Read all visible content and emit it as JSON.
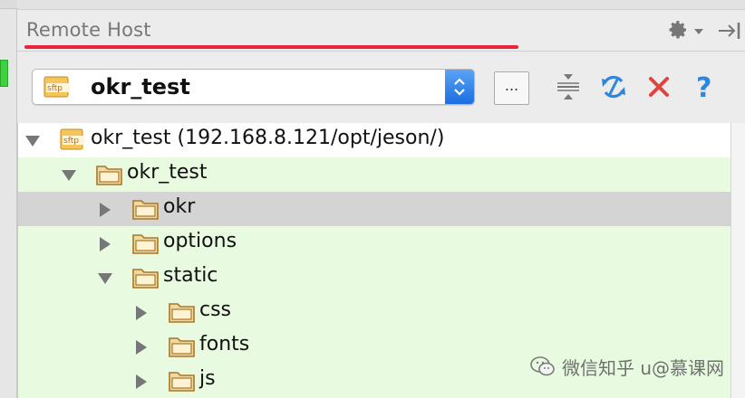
{
  "panel": {
    "title": "Remote Host",
    "accent_underline_color": "#e8253c"
  },
  "header_icons": {
    "settings": "gear-icon",
    "settings_menu": "chevron-down-icon",
    "hide": "hide-panel-icon"
  },
  "toolbar": {
    "host_select": {
      "value": "okr_test",
      "icon": "sftp-icon",
      "icon_text": "sftp"
    },
    "browse_label": "...",
    "actions": [
      {
        "name": "collapse-all-icon"
      },
      {
        "name": "sync-icon",
        "color": "#2e86de"
      },
      {
        "name": "close-icon",
        "color": "#e0443e"
      },
      {
        "name": "help-icon",
        "color": "#2e86de"
      }
    ]
  },
  "tree": {
    "background_color": "#e8fae0",
    "selected_color": "#d4d4d4",
    "items": [
      {
        "label": "okr_test (192.168.8.121/opt/jeson/)",
        "depth": 0,
        "expanded": true,
        "icon": "sftp-icon"
      },
      {
        "label": "okr_test",
        "depth": 1,
        "expanded": true,
        "icon": "folder-icon"
      },
      {
        "label": "okr",
        "depth": 2,
        "expanded": false,
        "icon": "folder-icon",
        "selected": true
      },
      {
        "label": "options",
        "depth": 2,
        "expanded": false,
        "icon": "folder-icon"
      },
      {
        "label": "static",
        "depth": 2,
        "expanded": true,
        "icon": "folder-icon"
      },
      {
        "label": "css",
        "depth": 3,
        "expanded": false,
        "icon": "folder-icon"
      },
      {
        "label": "fonts",
        "depth": 3,
        "expanded": false,
        "icon": "folder-icon"
      },
      {
        "label": "js",
        "depth": 3,
        "expanded": false,
        "icon": "folder-icon"
      }
    ]
  },
  "watermark": {
    "text": "微信知乎 u@慕课网",
    "icon": "wechat-icon"
  }
}
